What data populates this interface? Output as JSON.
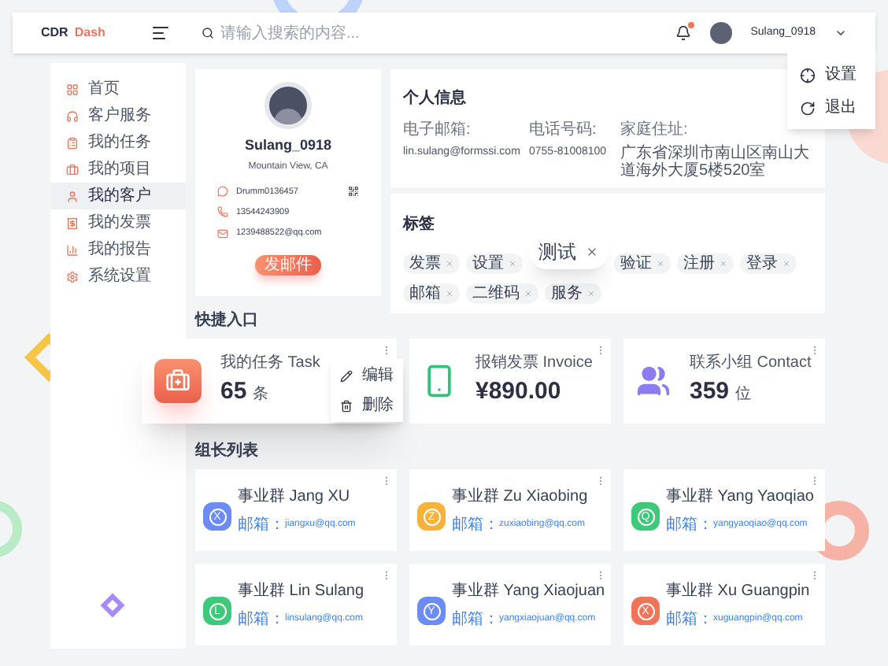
{
  "header": {
    "logo_primary": "CDR",
    "logo_accent": "Dash",
    "search": {
      "placeholder": "请输入搜索的内容..."
    },
    "notifications_unread": true,
    "user_name": "Sulang_0918"
  },
  "user_menu": {
    "items": [
      {
        "kind": "settings",
        "label": "设置"
      },
      {
        "kind": "logout",
        "label": "退出"
      }
    ]
  },
  "sidebar": {
    "items": [
      {
        "kind": "home",
        "label": "首页",
        "selected": false
      },
      {
        "kind": "service",
        "label": "客户服务",
        "selected": false
      },
      {
        "kind": "task",
        "label": "我的任务",
        "selected": false
      },
      {
        "kind": "project",
        "label": "我的项目",
        "selected": false
      },
      {
        "kind": "customer",
        "label": "我的客户",
        "selected": true
      },
      {
        "kind": "invoice",
        "label": "我的发票",
        "selected": false
      },
      {
        "kind": "report",
        "label": "我的报告",
        "selected": false
      },
      {
        "kind": "settings",
        "label": "系统设置",
        "selected": false
      }
    ]
  },
  "profile": {
    "name": "Sulang_0918",
    "location": "Mountain View, CA",
    "contacts": [
      {
        "kind": "chat",
        "value": "Drumm0136457"
      },
      {
        "kind": "phone",
        "value": "13544243909"
      },
      {
        "kind": "mail",
        "value": "1239488522@qq.com"
      }
    ],
    "button": "发邮件"
  },
  "personal_info": {
    "title": "个人信息",
    "fields": [
      {
        "label": "电子邮箱:",
        "value": "lin.sulang@formssi.com"
      },
      {
        "label": "电话号码:",
        "value": "0755-81008100"
      },
      {
        "label": "家庭住址:",
        "value": "广东省深圳市南山区南山大道海外大厦5楼520室"
      }
    ],
    "tags_title": "标签",
    "tags": [
      "发票",
      "设置",
      "验证",
      "注册",
      "登录",
      "邮箱",
      "二维码",
      "服务"
    ],
    "floating_tag": "测试"
  },
  "quick_entry": {
    "title": "快捷入口",
    "cards": [
      {
        "kind": "task",
        "label": "我的任务 Task",
        "value": "65",
        "unit": "条"
      },
      {
        "kind": "invoice",
        "label": "报销发票 Invoice",
        "value": "¥890.00"
      },
      {
        "kind": "contact",
        "label": "联系小组 Contact",
        "value": "359",
        "unit": "位"
      }
    ],
    "menu": [
      {
        "kind": "edit",
        "label": "编辑"
      },
      {
        "kind": "delete",
        "label": "删除"
      }
    ]
  },
  "team": {
    "title": "组长列表",
    "members": [
      {
        "name": "事业群 Jang XU",
        "email_label": "邮箱：",
        "email": "jiangxu@qq.com",
        "initial": "X",
        "color": "#6b8cf5"
      },
      {
        "name": "事业群 Zu Xiaobing",
        "email_label": "邮箱：",
        "email": "zuxiaobing@qq.com",
        "initial": "Z",
        "color": "#f7b23b"
      },
      {
        "name": "事业群 Yang Yaoqiao",
        "email_label": "邮箱：",
        "email": "yangyaoqiao@qq.com",
        "initial": "Q",
        "color": "#3ec97a"
      },
      {
        "name": "事业群 Lin Sulang",
        "email_label": "邮箱：",
        "email": "linsulang@qq.com",
        "initial": "L",
        "color": "#3ec97a"
      },
      {
        "name": "事业群 Yang Xiaojuan",
        "email_label": "邮箱：",
        "email": "yangxiaojuan@qq.com",
        "initial": "Y",
        "color": "#6b8cf5"
      },
      {
        "name": "事业群 Xu Guangpin",
        "email_label": "邮箱：",
        "email": "xuguangpin@qq.com",
        "initial": "X",
        "color": "#f0735a"
      }
    ]
  }
}
